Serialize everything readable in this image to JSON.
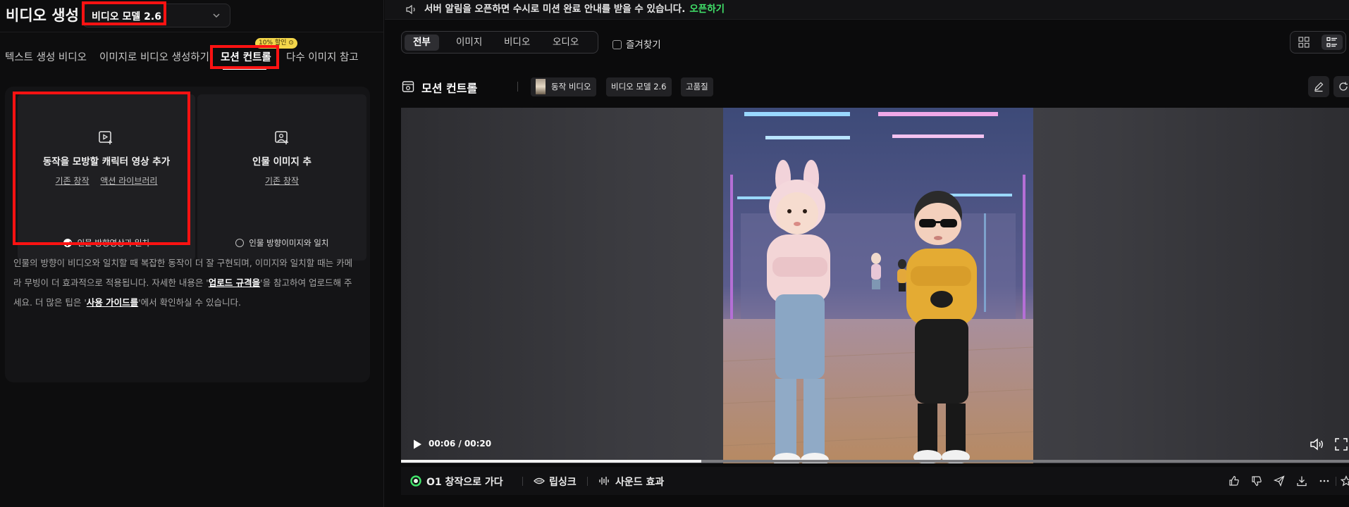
{
  "left_panel": {
    "title": "비디오 생성",
    "model_select": {
      "value": "비디오 모델 2.6"
    },
    "tabs": [
      {
        "label": "텍스트 생성 비디오"
      },
      {
        "label": "이미지로 비디오 생성하기"
      },
      {
        "label": "모션 컨트롤",
        "active": true
      },
      {
        "label": "다수 이미지 참고"
      }
    ],
    "promo_badge": "10% 할인 ⊙",
    "upload_character_video": {
      "title": "동작을 모방할 캐릭터 영상 추가",
      "links": [
        "기존 창작",
        "액션 라이브러리"
      ],
      "option": "인물 방향영상과 일치",
      "option_selected": true
    },
    "upload_person_image": {
      "title": "인물 이미지 추",
      "links": [
        "기존 창작"
      ],
      "option": "인물 방향이미지와 일치",
      "option_selected": false
    },
    "description": {
      "part1": "인물의 방향이 비디오와 일치할 때 복잡한 동작이 더 잘 구현되며, 이미지와 일치할 때는 카메라 무빙이 더 효과적으로 적용됩니다. 자세한 내용은 '",
      "link1": "업로드 규격을",
      "part2": "'을 참고하여 업로드해 주세요. 더 많은 팁은 '",
      "link2": "사용 가이드를",
      "part3": "'에서 확인하실 수 있습니다."
    }
  },
  "notice": {
    "text": "서버 알림을 오픈하면 수시로 미션 완료 안내를 받을 수 있습니다.",
    "link": "오픈하기"
  },
  "filters": {
    "segments": [
      {
        "label": "전부",
        "active": true
      },
      {
        "label": "이미지"
      },
      {
        "label": "비디오"
      },
      {
        "label": "오디오"
      }
    ],
    "favorites_label": "즐겨찾기"
  },
  "result": {
    "title": "모션 컨트롤",
    "chips": [
      "동작 비디오",
      "비디오 모델 2.6",
      "고품질"
    ]
  },
  "player": {
    "time": "00:06 / 00:20",
    "progress": 0.317
  },
  "actions": {
    "o1_label": "O1 창작으로 가다",
    "lipsync_label": "립싱크",
    "sound_label": "사운드 효과"
  },
  "colors": {
    "accent_green": "#41e36a",
    "highlight_red": "#ff1212"
  }
}
